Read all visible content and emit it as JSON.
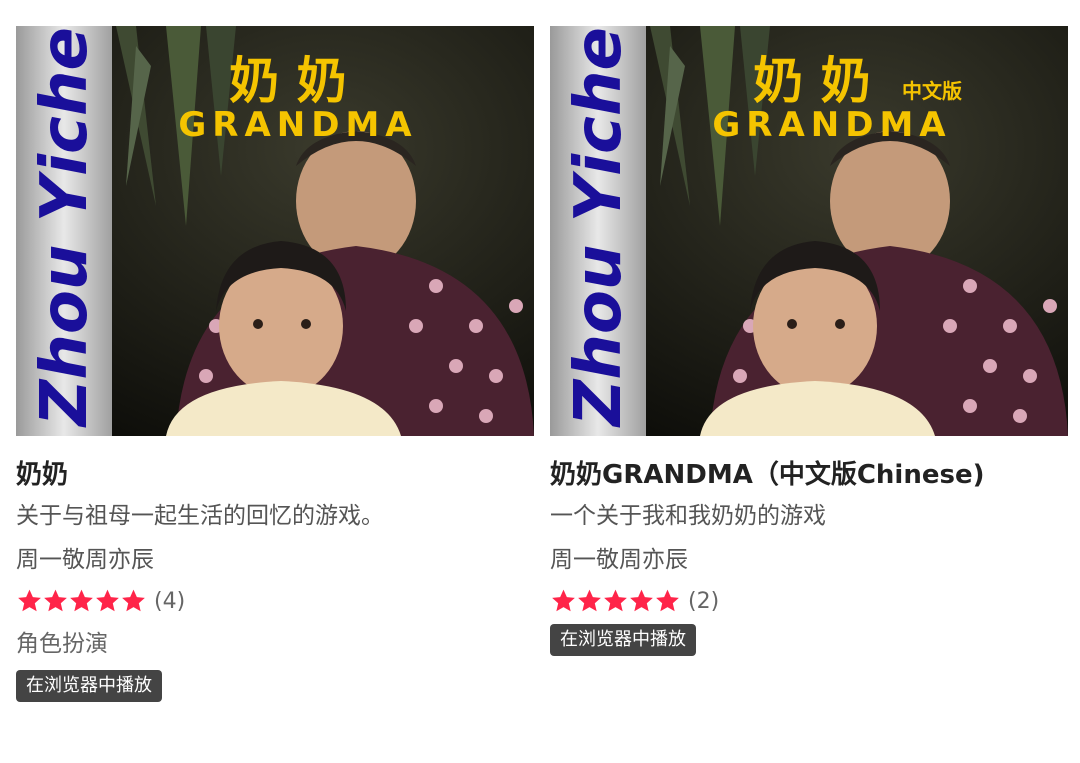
{
  "games": [
    {
      "cover": {
        "side_text": "Zhou Yichen",
        "title_cn": "奶 奶",
        "title_en": "GRANDMA",
        "edition_tag": ""
      },
      "title": "奶奶",
      "description": "关于与祖母一起生活的回忆的游戏。",
      "author": "周一敬周亦辰",
      "rating": {
        "stars": 5,
        "count_text": "(4)"
      },
      "genre": "角色扮演",
      "play_label": "在浏览器中播放"
    },
    {
      "cover": {
        "side_text": "Zhou Yichen",
        "title_cn": "奶 奶",
        "title_en": "GRANDMA",
        "edition_tag": "中文版"
      },
      "title": "奶奶GRANDMA（中文版Chinese)",
      "description": "一个关于我和我奶奶的游戏",
      "author": "周一敬周亦辰",
      "rating": {
        "stars": 5,
        "count_text": "(2)"
      },
      "genre": "",
      "play_label": "在浏览器中播放"
    }
  ],
  "colors": {
    "star": "#ff2449",
    "badge_bg": "#444444",
    "cover_title": "#f5c400",
    "cover_side_text": "#1a0f9a"
  }
}
